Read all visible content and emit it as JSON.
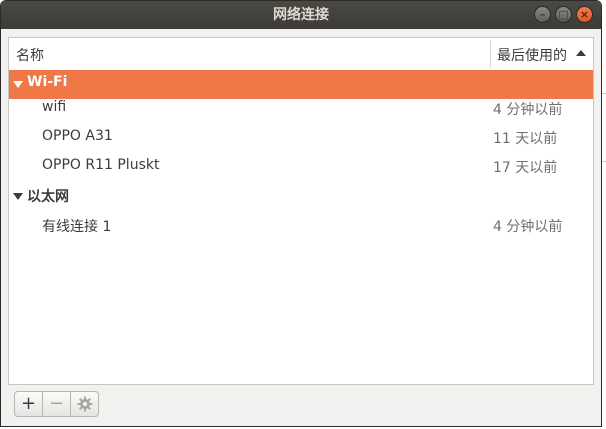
{
  "window": {
    "title": "网络连接"
  },
  "header": {
    "name": "名称",
    "last_used": "最后使用的"
  },
  "groups": [
    {
      "label": "Wi-Fi",
      "selected": true,
      "items": [
        {
          "name": "wifi",
          "last_used": "4 分钟以前"
        },
        {
          "name": "OPPO A31",
          "last_used": "11 天以前"
        },
        {
          "name": "OPPO R11 Pluskt",
          "last_used": "17 天以前"
        }
      ]
    },
    {
      "label": "以太网",
      "selected": false,
      "items": [
        {
          "name": "有线连接 1",
          "last_used": "4 分钟以前"
        }
      ]
    }
  ],
  "toolbar": {
    "add": "+",
    "remove": "−",
    "settings_icon": "gear-icon"
  },
  "colors": {
    "selection": "#f07746",
    "titlebar": "#3c3b37",
    "close": "#e95420"
  }
}
